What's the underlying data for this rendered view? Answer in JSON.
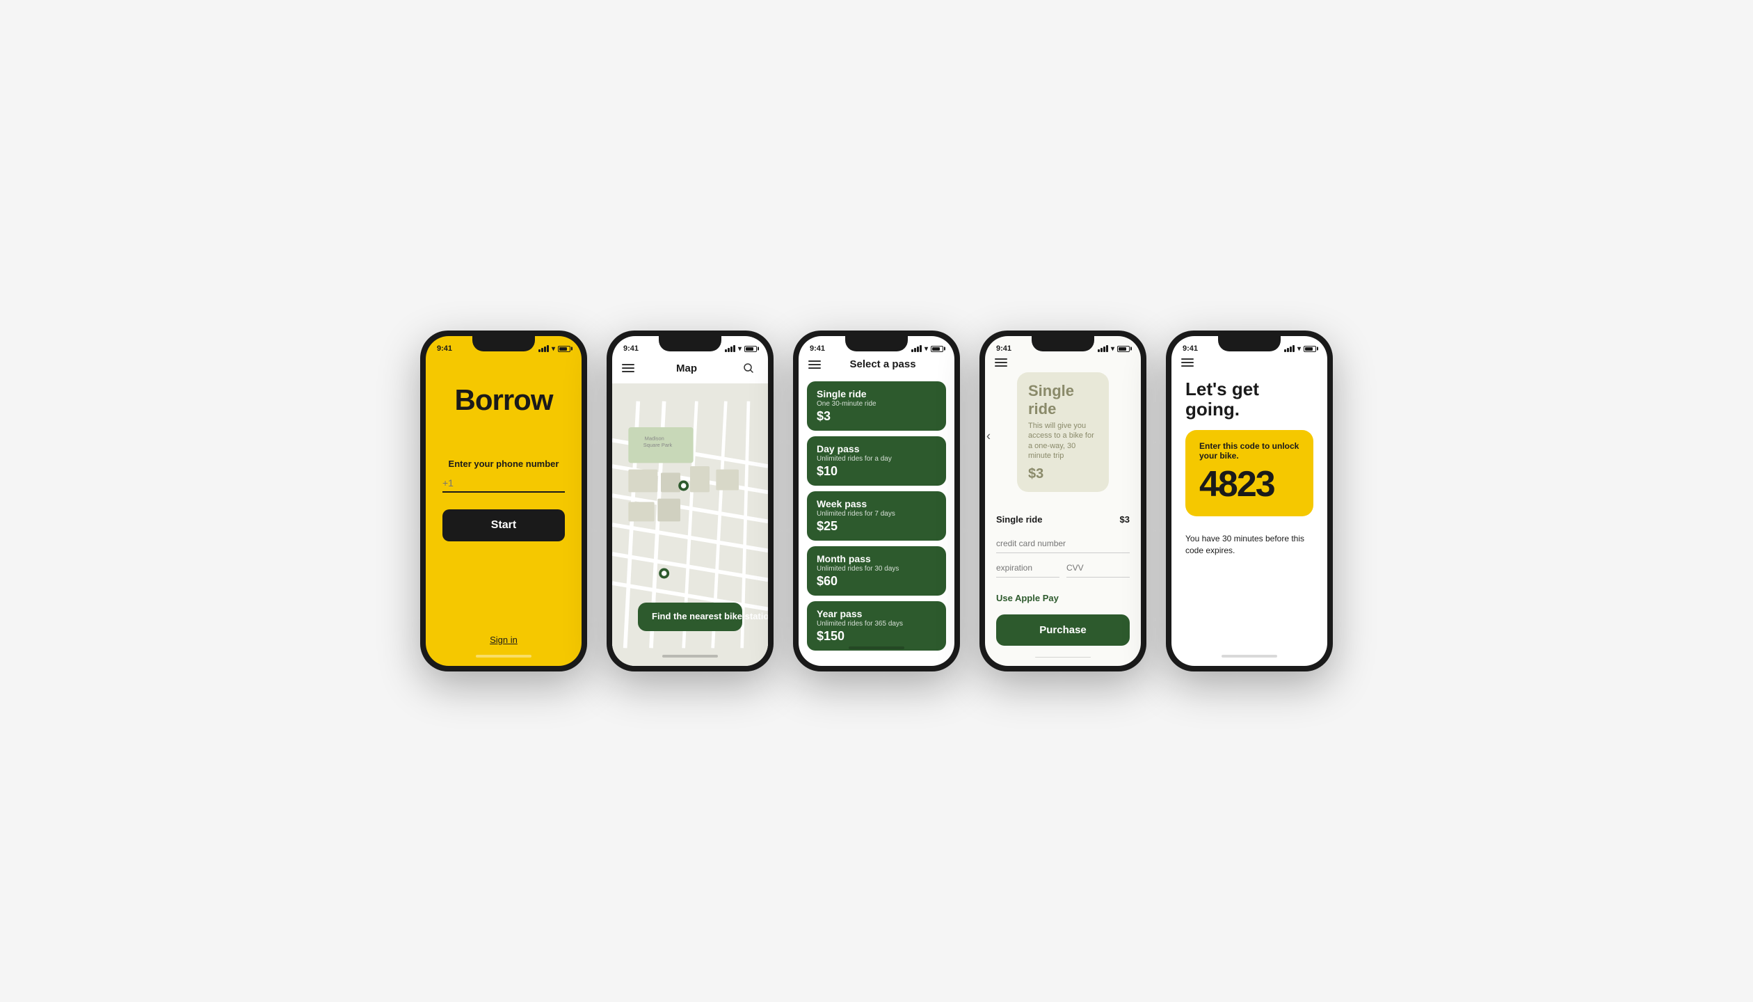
{
  "app": {
    "name": "Borrow",
    "status_time": "9:41"
  },
  "phone1": {
    "title": "Borrow",
    "enter_phone_label": "Enter your phone number",
    "phone_placeholder": "+1",
    "start_button": "Start",
    "sign_in": "Sign in"
  },
  "phone2": {
    "header_title": "Map",
    "find_station_button": "Find the nearest bike station"
  },
  "phone3": {
    "header_title": "Select a pass",
    "passes": [
      {
        "name": "Single ride",
        "desc": "One 30-minute ride",
        "price": "$3"
      },
      {
        "name": "Day pass",
        "desc": "Unlimited rides for a day",
        "price": "$10"
      },
      {
        "name": "Week pass",
        "desc": "Unlimited rides for 7 days",
        "price": "$25"
      },
      {
        "name": "Month pass",
        "desc": "Unlimited rides for 30 days",
        "price": "$60"
      },
      {
        "name": "Year pass",
        "desc": "Unlimited rides for 365 days",
        "price": "$150"
      }
    ]
  },
  "phone4": {
    "selected_pass_name": "Single ride",
    "selected_pass_desc": "This will give you access to a bike for a one-way, 30 minute trip",
    "selected_pass_price": "$3",
    "summary_label": "Single ride",
    "summary_price": "$3",
    "cc_placeholder": "credit card number",
    "expiration_placeholder": "expiration",
    "cvv_placeholder": "CVV",
    "apple_pay": "Use Apple Pay",
    "purchase_button": "Purchase"
  },
  "phone5": {
    "heading": "Let's get going.",
    "code_label": "Enter this code to unlock your bike.",
    "code": "4823",
    "expires_note": "You have 30 minutes before this code expires."
  },
  "colors": {
    "yellow": "#F5C800",
    "dark_green": "#2d5a2d",
    "dark": "#1a1a1a",
    "beige": "#e8e8d8"
  }
}
